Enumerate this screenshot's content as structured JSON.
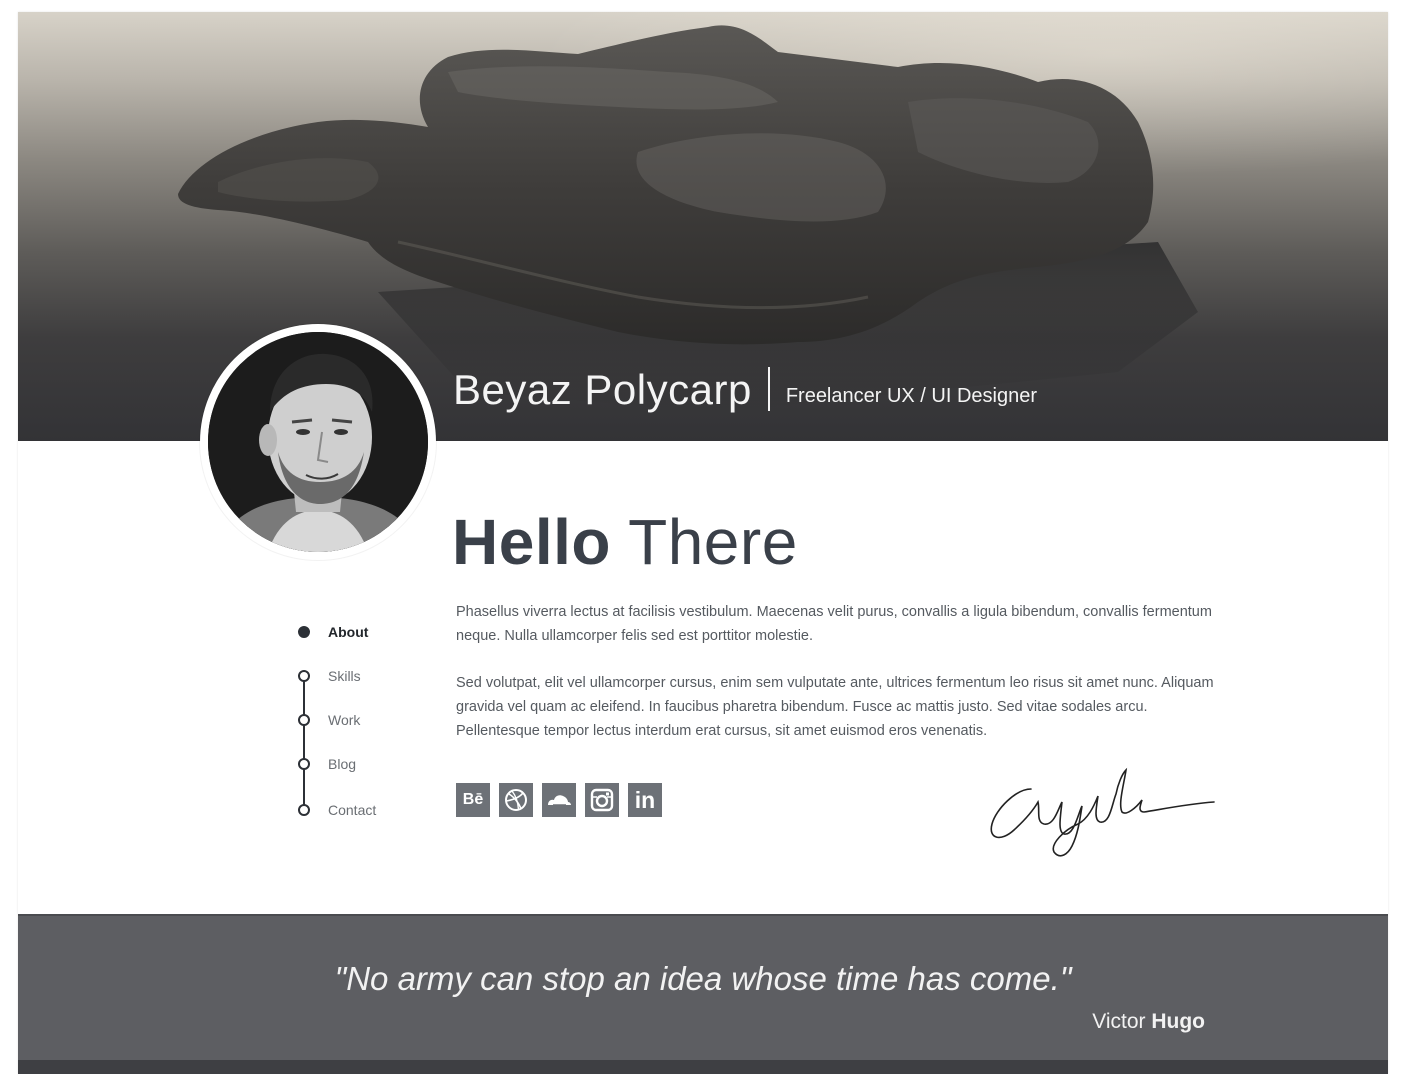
{
  "profile": {
    "name": "Beyaz Polycarp",
    "separator": "|",
    "role": "Freelancer UX / UI Designer"
  },
  "greeting": {
    "strong": "Hello",
    "light": "There"
  },
  "bio": {
    "paragraphs": [
      "Phasellus viverra lectus at facilisis vestibulum. Maecenas velit purus, convallis a ligula bibendum, convallis fermentum neque. Nulla ullamcorper felis sed est porttitor molestie.",
      "Sed volutpat, elit vel ullamcorper cursus, enim sem vulputate ante, ultrices fermentum leo risus sit amet nunc. Aliquam gravida vel quam ac eleifend. In faucibus pharetra bibendum. Fusce ac mattis justo. Sed vitae sodales arcu. Pellentesque tempor lectus interdum erat cursus, sit amet euismod eros venenatis."
    ]
  },
  "nav": {
    "items": [
      {
        "label": "About",
        "active": true
      },
      {
        "label": "Skills",
        "active": false
      },
      {
        "label": "Work",
        "active": false
      },
      {
        "label": "Blog",
        "active": false
      },
      {
        "label": "Contact",
        "active": false
      }
    ]
  },
  "social": {
    "behance": {
      "icon": "behance-icon",
      "glyph": "Bē"
    },
    "dribbble": {
      "icon": "dribbble-icon"
    },
    "cloud": {
      "icon": "cloud-icon"
    },
    "instagram": {
      "icon": "instagram-icon"
    },
    "linkedin": {
      "icon": "linkedin-icon",
      "glyph": "in"
    }
  },
  "quote": {
    "text": "\"No army can stop an idea whose time has come.\"",
    "author_first": "Victor",
    "author_last": "Hugo"
  },
  "colors": {
    "heading": "#3a4049",
    "body_text": "#555a60",
    "social_bg": "#6d7177",
    "quote_band": "#5d5e62",
    "bottom_band": "#3e3f43"
  }
}
